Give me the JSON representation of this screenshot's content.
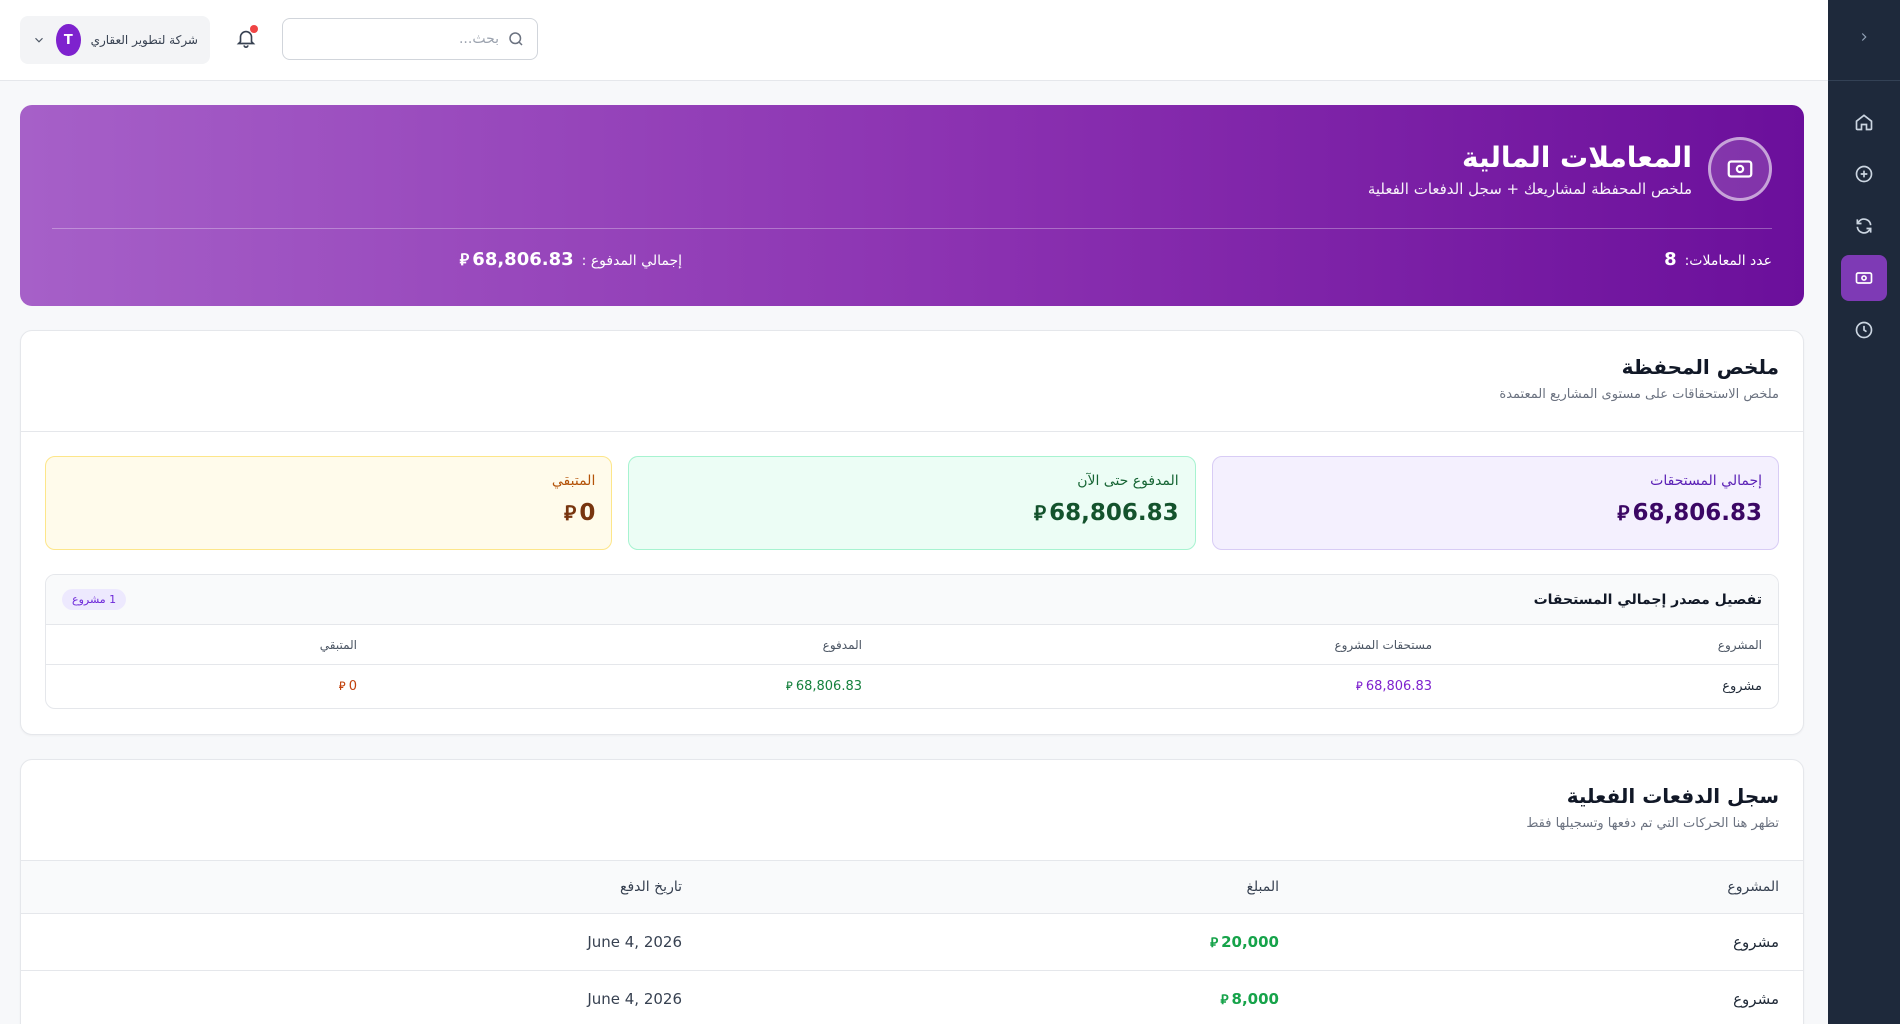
{
  "topbar": {
    "company_name": "شركة لتطوير العقاري",
    "avatar_letter": "T",
    "search_placeholder": "بحث..."
  },
  "sidebar": {
    "items": [
      {
        "name": "home-icon",
        "active": false
      },
      {
        "name": "plus-circle-icon",
        "active": false
      },
      {
        "name": "refresh-icon",
        "active": false
      },
      {
        "name": "money-icon",
        "active": true
      },
      {
        "name": "clock-icon",
        "active": false
      }
    ]
  },
  "hero": {
    "title": "المعاملات المالية",
    "subtitle": "ملخص المحفظة لمشاريعك + سجل الدفعات الفعلية",
    "count_label": "عدد المعاملات:",
    "count_value": "8",
    "total_paid_label": "إجمالي المدفوع :",
    "total_paid_value": "68,806.83",
    "currency_symbol": "⃁"
  },
  "portfolio": {
    "title": "ملخص المحفظة",
    "subtitle": "ملخص الاستحقاقات على مستوى المشاريع المعتمدة",
    "cards": [
      {
        "label": "إجمالي المستحقات",
        "value": "68,806.83"
      },
      {
        "label": "المدفوع حتى الآن",
        "value": "68,806.83"
      },
      {
        "label": "المتبقي",
        "value": "0"
      }
    ],
    "breakdown": {
      "title": "تفصيل مصدر إجمالي المستحقات",
      "badge": "1 مشروع",
      "columns": [
        "المشروع",
        "مستحقات المشروع",
        "المدفوع",
        "المتبقي"
      ],
      "rows": [
        {
          "project": "مشروع",
          "due": "68,806.83",
          "paid": "68,806.83",
          "remaining": "0"
        }
      ]
    }
  },
  "payments": {
    "title": "سجل الدفعات الفعلية",
    "subtitle": "تظهر هنا الحركات التي تم دفعها وتسجيلها فقط",
    "columns": [
      "المشروع",
      "المبلغ",
      "تاريخ الدفع"
    ],
    "rows": [
      {
        "project": "مشروع",
        "amount": "20,000",
        "date": "June 4, 2026"
      },
      {
        "project": "مشروع",
        "amount": "8,000",
        "date": "June 4, 2026"
      }
    ]
  }
}
